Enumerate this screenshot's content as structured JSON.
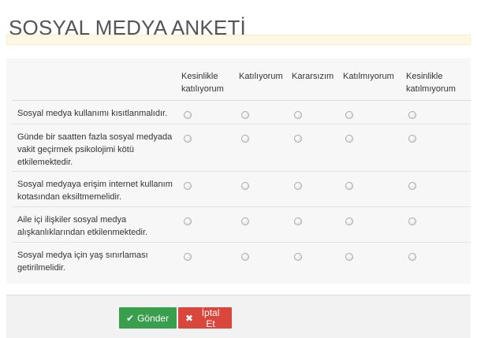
{
  "page": {
    "title": "SOSYAL MEDYA ANKETİ"
  },
  "notice": {
    "text": ""
  },
  "survey": {
    "columns": [
      "Kesinlikle\nkatılıyorum",
      "Katılıyorum",
      "Kararsızım",
      "Katılmıyorum",
      "Kesinlikle\nkatılmıyorum"
    ],
    "questions": [
      "Sosyal medya kullanımı kısıtlanmalıdır.",
      "Günde bir saatten fazla sosyal medyada vakit geçirmek psikolojimi kötü etkilemektedir.",
      "Sosyal medyaya erişim internet kullanım kotasından eksiltmemelidir.",
      "Aile içi ilişkiler sosyal medya alışkanlıklarından etkilenmektedir.",
      "Sosyal medya için yaş sınırlaması getirilmelidir."
    ]
  },
  "footer": {
    "submit_label": "Gönder",
    "submit_icon": "check-icon",
    "cancel_label": "İptal Et",
    "cancel_icon": "close-icon"
  },
  "colors": {
    "submit": "#3a9f4d",
    "cancel": "#d9463b",
    "notice_bg": "#fcf8e3"
  }
}
